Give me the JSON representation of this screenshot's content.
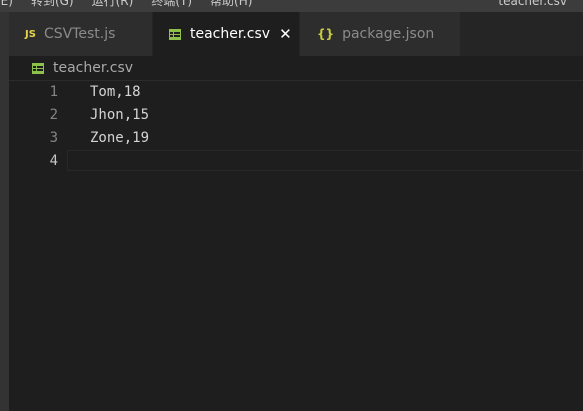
{
  "menubar": {
    "items": [
      "(E)",
      "转到(G)",
      "运行(R)",
      "终端(T)",
      "帮助(H)"
    ],
    "window_title": "teacher.csv"
  },
  "tabs": [
    {
      "icon": "JS",
      "label": "CSVTest.js",
      "active": false
    },
    {
      "icon": "csv-table-icon",
      "label": "teacher.csv",
      "active": true,
      "close": "✕"
    },
    {
      "icon": "{}",
      "label": "package.json",
      "active": false
    }
  ],
  "breadcrumb": {
    "label": "teacher.csv"
  },
  "editor": {
    "lines": [
      {
        "number": "1",
        "code": "Tom,18"
      },
      {
        "number": "2",
        "code": "Jhon,15"
      },
      {
        "number": "3",
        "code": "Zone,19"
      },
      {
        "number": "4",
        "code": ""
      }
    ]
  },
  "colors": {
    "editor_bg": "#1e1e1e",
    "tabbar_bg": "#252526",
    "inactive_tab_bg": "#2d2d2d",
    "csv_icon": "#8dc149",
    "js_icon": "#e8d44d",
    "json_icon": "#cbcb41"
  }
}
